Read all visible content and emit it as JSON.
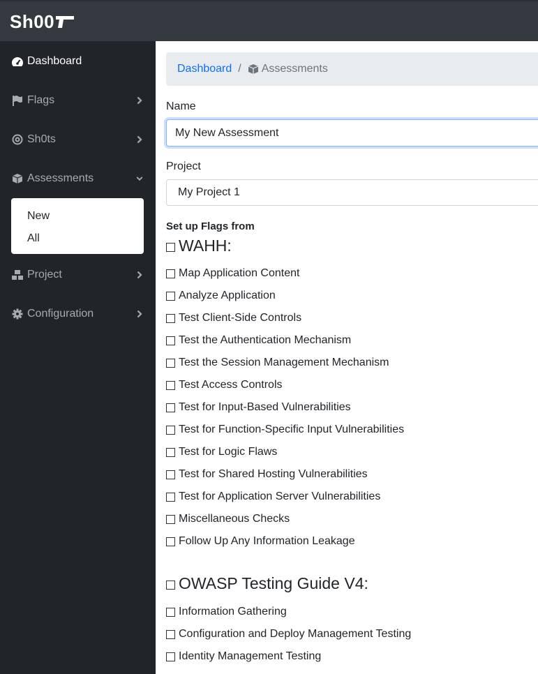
{
  "app": {
    "logo_text": "Sh00"
  },
  "sidebar": {
    "items": [
      {
        "label": "Dashboard",
        "icon": "gauge-icon",
        "active": true
      },
      {
        "label": "Flags",
        "icon": "flag-icon"
      },
      {
        "label": "Sh0ts",
        "icon": "target-icon"
      },
      {
        "label": "Assessments",
        "icon": "box-icon",
        "expanded": true
      },
      {
        "label": "Project",
        "icon": "cubes-icon"
      },
      {
        "label": "Configuration",
        "icon": "gear-icon"
      }
    ],
    "assessments_submenu": [
      {
        "label": "New"
      },
      {
        "label": "All"
      }
    ]
  },
  "breadcrumb": {
    "home": "Dashboard",
    "separator": "/",
    "current": "Assessments"
  },
  "form": {
    "name_label": "Name",
    "name_value": "My New Assessment",
    "project_label": "Project",
    "project_value": "My Project 1",
    "flags_section_label": "Set up Flags from"
  },
  "groups": [
    {
      "title": "WAHH:",
      "items": [
        "Map Application Content",
        "Analyze Application",
        "Test Client-Side Controls",
        "Test the Authentication Mechanism",
        "Test the Session Management Mechanism",
        "Test Access Controls",
        "Test for Input-Based Vulnerabilities",
        "Test for Function-Specific Input Vulnerabilities",
        "Test for Logic Flaws",
        "Test for Shared Hosting Vulnerabilities",
        "Test for Application Server Vulnerabilities",
        "Miscellaneous Checks",
        "Follow Up Any Information Leakage"
      ]
    },
    {
      "title": "OWASP Testing Guide V4:",
      "items": [
        "Information Gathering",
        "Configuration and Deploy Management Testing",
        "Identity Management Testing"
      ]
    }
  ],
  "colors": {
    "topbar": "#343a40",
    "sidebar": "#212529",
    "link": "#0d6efd",
    "breadcrumb_bg": "#e9ecef"
  }
}
